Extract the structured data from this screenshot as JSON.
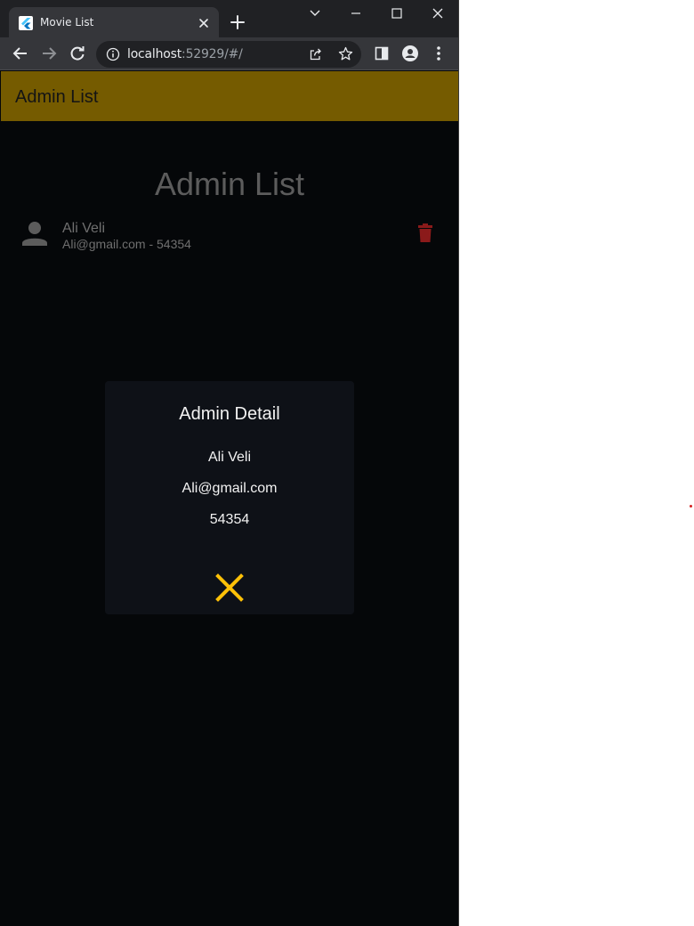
{
  "browser": {
    "tab_title": "Movie List",
    "url_host": "localhost",
    "url_rest": ":52929/#/"
  },
  "app": {
    "appbar_title": "Admin List",
    "page_heading": "Admin List",
    "admins": [
      {
        "name": "Ali Veli",
        "subtitle": "Ali@gmail.com - 54354"
      }
    ]
  },
  "dialog": {
    "title": "Admin Detail",
    "name": "Ali Veli",
    "email": "Ali@gmail.com",
    "phone": "54354"
  },
  "icons": {
    "favicon": "flutter-icon",
    "avatar": "person-icon",
    "delete": "trash-icon",
    "close": "close-icon"
  },
  "colors": {
    "appbar": "#755b00",
    "accent": "#ffc107",
    "delete": "#8b1a1a"
  }
}
